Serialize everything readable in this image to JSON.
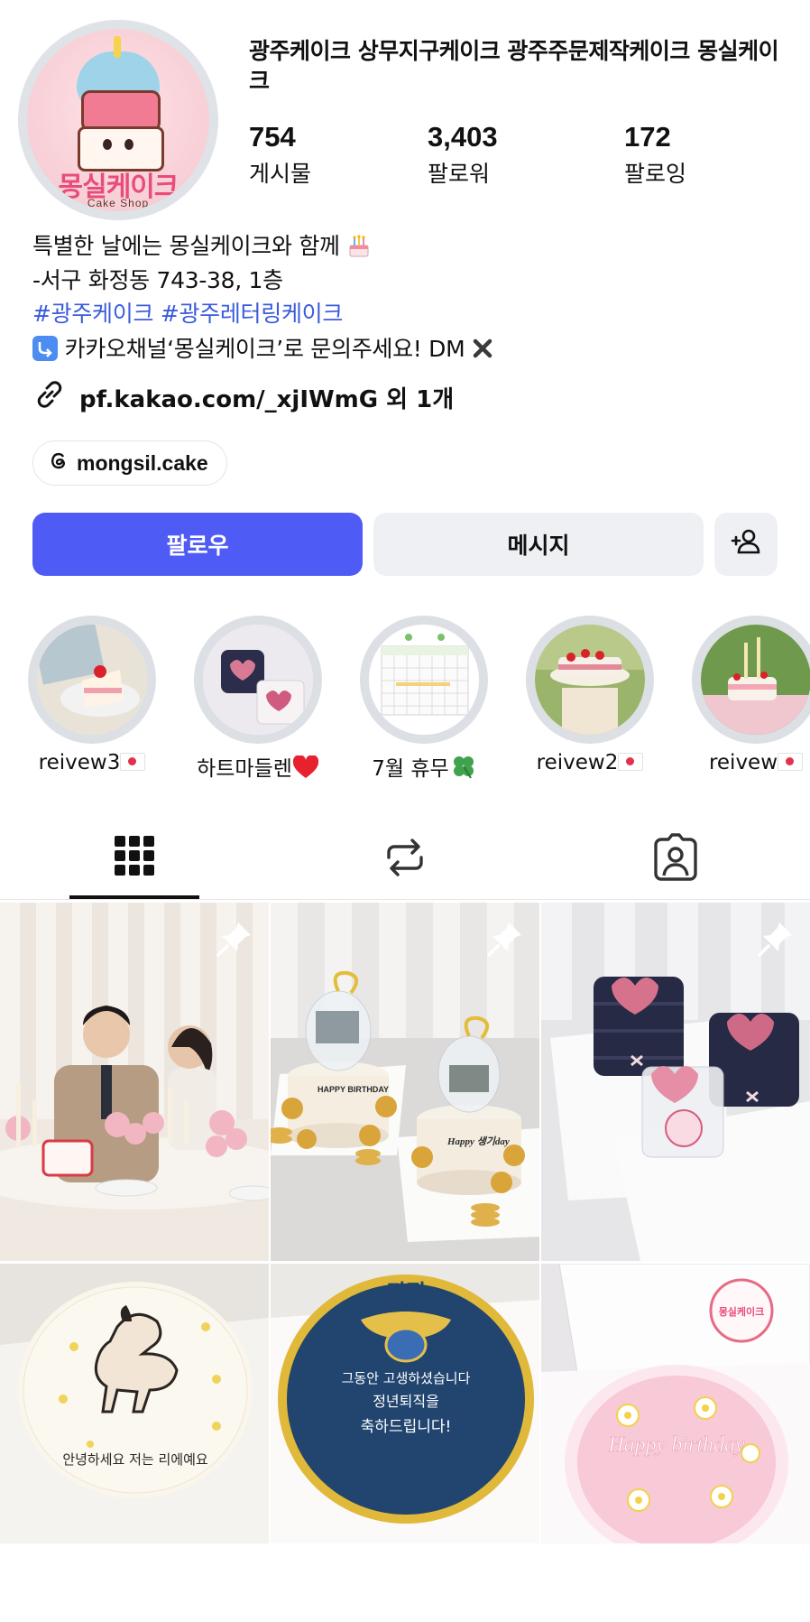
{
  "profile": {
    "name": "광주케이크 상무지구케이크 광주주문제작케이크 몽실케이크",
    "avatar": {
      "logo_text": "몽실케이크",
      "logo_subtext": "Cake Shop"
    }
  },
  "stats": [
    {
      "value": "754",
      "label": "게시물"
    },
    {
      "value": "3,403",
      "label": "팔로워"
    },
    {
      "value": "172",
      "label": "팔로잉"
    }
  ],
  "bio": {
    "line1": "특별한 날에는 몽실케이크와 함께",
    "line2": "-서구 화정동 743-38, 1층",
    "hashtag1": "#광주케이크",
    "hashtag2": "#광주레터링케이크",
    "line4": "카카오채널‘몽실케이크’로 문의주세요! DM",
    "link": "pf.kakao.com/_xjIWmG 외 1개",
    "icons": [
      "birthday-cake-emoji",
      "arrow-down-right-emoji",
      "cross-mark-emoji",
      "link-icon"
    ]
  },
  "threads": {
    "handle": "mongsil.cake",
    "icon": "threads-icon"
  },
  "actions": {
    "follow": "팔로우",
    "message": "메시지",
    "add_person_icon": "add-person-icon"
  },
  "highlights": [
    {
      "label": "reivew3"
    },
    {
      "label": "하트마들렌"
    },
    {
      "label": "7월 휴무"
    },
    {
      "label": "reivew2"
    },
    {
      "label": "reivew"
    }
  ],
  "tabs": [
    {
      "icon": "grid-icon",
      "selected": true
    },
    {
      "icon": "reels-repost-icon",
      "selected": false
    },
    {
      "icon": "tagged-icon",
      "selected": false
    }
  ],
  "colors": {
    "follow_button": "#4f5bf5",
    "secondary_button": "#eef0f3",
    "hashtag": "#3b5bdb",
    "ring": "#dcdfe4"
  },
  "posts": [
    {
      "pinned": true,
      "description": "couple-dinner"
    },
    {
      "pinned": true,
      "description": "money-cakes"
    },
    {
      "pinned": true,
      "description": "heart-madeleine-boxes"
    },
    {
      "pinned": false,
      "description": "horse-cake"
    },
    {
      "pinned": false,
      "description": "retirement-cake"
    },
    {
      "pinned": false,
      "description": "pink-birthday-cake"
    }
  ],
  "post_text": {
    "cake1_top": "HAPPY BIRTHDAY",
    "cake2_top": "Happy 생기day",
    "horse_cake": "안녕하세요 저는 리에예요",
    "retire_title": "퇴직",
    "retire_msg1": "그동안 고생하셨습니다",
    "retire_msg2": "정년퇴직을",
    "retire_msg3": "축하드립니다!",
    "pink_cake": "Happy birthday",
    "box_logo": "몽실케이크"
  }
}
